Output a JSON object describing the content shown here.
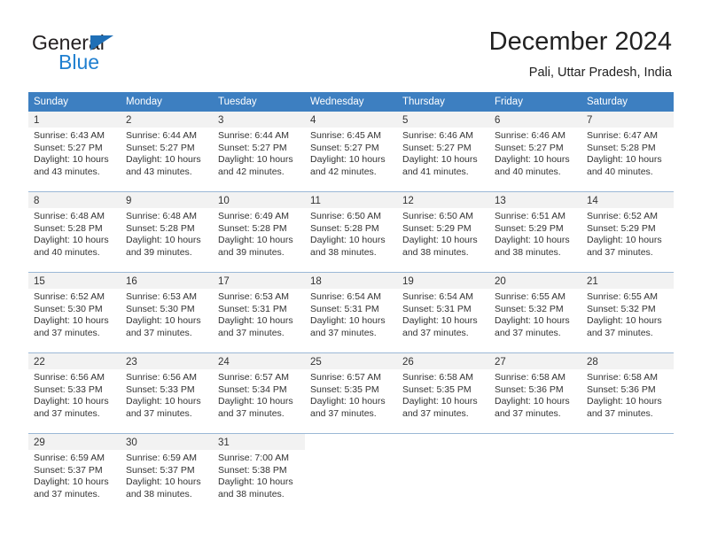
{
  "brand": {
    "name_part1": "General",
    "name_part2": "Blue",
    "triangle_color": "#1f6fb6",
    "blue_text_color": "#1f7fd0"
  },
  "header": {
    "title": "December 2024",
    "subtitle": "Pali, Uttar Pradesh, India",
    "accent_color": "#3d7fc1"
  },
  "weekdays": [
    "Sunday",
    "Monday",
    "Tuesday",
    "Wednesday",
    "Thursday",
    "Friday",
    "Saturday"
  ],
  "labels": {
    "sunrise_prefix": "Sunrise:",
    "sunset_prefix": "Sunset:",
    "daylight_prefix": "Daylight:"
  },
  "weeks": [
    [
      {
        "day": "1",
        "sunrise": "Sunrise: 6:43 AM",
        "sunset": "Sunset: 5:27 PM",
        "daylight1": "Daylight: 10 hours",
        "daylight2": "and 43 minutes."
      },
      {
        "day": "2",
        "sunrise": "Sunrise: 6:44 AM",
        "sunset": "Sunset: 5:27 PM",
        "daylight1": "Daylight: 10 hours",
        "daylight2": "and 43 minutes."
      },
      {
        "day": "3",
        "sunrise": "Sunrise: 6:44 AM",
        "sunset": "Sunset: 5:27 PM",
        "daylight1": "Daylight: 10 hours",
        "daylight2": "and 42 minutes."
      },
      {
        "day": "4",
        "sunrise": "Sunrise: 6:45 AM",
        "sunset": "Sunset: 5:27 PM",
        "daylight1": "Daylight: 10 hours",
        "daylight2": "and 42 minutes."
      },
      {
        "day": "5",
        "sunrise": "Sunrise: 6:46 AM",
        "sunset": "Sunset: 5:27 PM",
        "daylight1": "Daylight: 10 hours",
        "daylight2": "and 41 minutes."
      },
      {
        "day": "6",
        "sunrise": "Sunrise: 6:46 AM",
        "sunset": "Sunset: 5:27 PM",
        "daylight1": "Daylight: 10 hours",
        "daylight2": "and 40 minutes."
      },
      {
        "day": "7",
        "sunrise": "Sunrise: 6:47 AM",
        "sunset": "Sunset: 5:28 PM",
        "daylight1": "Daylight: 10 hours",
        "daylight2": "and 40 minutes."
      }
    ],
    [
      {
        "day": "8",
        "sunrise": "Sunrise: 6:48 AM",
        "sunset": "Sunset: 5:28 PM",
        "daylight1": "Daylight: 10 hours",
        "daylight2": "and 40 minutes."
      },
      {
        "day": "9",
        "sunrise": "Sunrise: 6:48 AM",
        "sunset": "Sunset: 5:28 PM",
        "daylight1": "Daylight: 10 hours",
        "daylight2": "and 39 minutes."
      },
      {
        "day": "10",
        "sunrise": "Sunrise: 6:49 AM",
        "sunset": "Sunset: 5:28 PM",
        "daylight1": "Daylight: 10 hours",
        "daylight2": "and 39 minutes."
      },
      {
        "day": "11",
        "sunrise": "Sunrise: 6:50 AM",
        "sunset": "Sunset: 5:28 PM",
        "daylight1": "Daylight: 10 hours",
        "daylight2": "and 38 minutes."
      },
      {
        "day": "12",
        "sunrise": "Sunrise: 6:50 AM",
        "sunset": "Sunset: 5:29 PM",
        "daylight1": "Daylight: 10 hours",
        "daylight2": "and 38 minutes."
      },
      {
        "day": "13",
        "sunrise": "Sunrise: 6:51 AM",
        "sunset": "Sunset: 5:29 PM",
        "daylight1": "Daylight: 10 hours",
        "daylight2": "and 38 minutes."
      },
      {
        "day": "14",
        "sunrise": "Sunrise: 6:52 AM",
        "sunset": "Sunset: 5:29 PM",
        "daylight1": "Daylight: 10 hours",
        "daylight2": "and 37 minutes."
      }
    ],
    [
      {
        "day": "15",
        "sunrise": "Sunrise: 6:52 AM",
        "sunset": "Sunset: 5:30 PM",
        "daylight1": "Daylight: 10 hours",
        "daylight2": "and 37 minutes."
      },
      {
        "day": "16",
        "sunrise": "Sunrise: 6:53 AM",
        "sunset": "Sunset: 5:30 PM",
        "daylight1": "Daylight: 10 hours",
        "daylight2": "and 37 minutes."
      },
      {
        "day": "17",
        "sunrise": "Sunrise: 6:53 AM",
        "sunset": "Sunset: 5:31 PM",
        "daylight1": "Daylight: 10 hours",
        "daylight2": "and 37 minutes."
      },
      {
        "day": "18",
        "sunrise": "Sunrise: 6:54 AM",
        "sunset": "Sunset: 5:31 PM",
        "daylight1": "Daylight: 10 hours",
        "daylight2": "and 37 minutes."
      },
      {
        "day": "19",
        "sunrise": "Sunrise: 6:54 AM",
        "sunset": "Sunset: 5:31 PM",
        "daylight1": "Daylight: 10 hours",
        "daylight2": "and 37 minutes."
      },
      {
        "day": "20",
        "sunrise": "Sunrise: 6:55 AM",
        "sunset": "Sunset: 5:32 PM",
        "daylight1": "Daylight: 10 hours",
        "daylight2": "and 37 minutes."
      },
      {
        "day": "21",
        "sunrise": "Sunrise: 6:55 AM",
        "sunset": "Sunset: 5:32 PM",
        "daylight1": "Daylight: 10 hours",
        "daylight2": "and 37 minutes."
      }
    ],
    [
      {
        "day": "22",
        "sunrise": "Sunrise: 6:56 AM",
        "sunset": "Sunset: 5:33 PM",
        "daylight1": "Daylight: 10 hours",
        "daylight2": "and 37 minutes."
      },
      {
        "day": "23",
        "sunrise": "Sunrise: 6:56 AM",
        "sunset": "Sunset: 5:33 PM",
        "daylight1": "Daylight: 10 hours",
        "daylight2": "and 37 minutes."
      },
      {
        "day": "24",
        "sunrise": "Sunrise: 6:57 AM",
        "sunset": "Sunset: 5:34 PM",
        "daylight1": "Daylight: 10 hours",
        "daylight2": "and 37 minutes."
      },
      {
        "day": "25",
        "sunrise": "Sunrise: 6:57 AM",
        "sunset": "Sunset: 5:35 PM",
        "daylight1": "Daylight: 10 hours",
        "daylight2": "and 37 minutes."
      },
      {
        "day": "26",
        "sunrise": "Sunrise: 6:58 AM",
        "sunset": "Sunset: 5:35 PM",
        "daylight1": "Daylight: 10 hours",
        "daylight2": "and 37 minutes."
      },
      {
        "day": "27",
        "sunrise": "Sunrise: 6:58 AM",
        "sunset": "Sunset: 5:36 PM",
        "daylight1": "Daylight: 10 hours",
        "daylight2": "and 37 minutes."
      },
      {
        "day": "28",
        "sunrise": "Sunrise: 6:58 AM",
        "sunset": "Sunset: 5:36 PM",
        "daylight1": "Daylight: 10 hours",
        "daylight2": "and 37 minutes."
      }
    ],
    [
      {
        "day": "29",
        "sunrise": "Sunrise: 6:59 AM",
        "sunset": "Sunset: 5:37 PM",
        "daylight1": "Daylight: 10 hours",
        "daylight2": "and 37 minutes."
      },
      {
        "day": "30",
        "sunrise": "Sunrise: 6:59 AM",
        "sunset": "Sunset: 5:37 PM",
        "daylight1": "Daylight: 10 hours",
        "daylight2": "and 38 minutes."
      },
      {
        "day": "31",
        "sunrise": "Sunrise: 7:00 AM",
        "sunset": "Sunset: 5:38 PM",
        "daylight1": "Daylight: 10 hours",
        "daylight2": "and 38 minutes."
      },
      {
        "day": "",
        "sunrise": "",
        "sunset": "",
        "daylight1": "",
        "daylight2": ""
      },
      {
        "day": "",
        "sunrise": "",
        "sunset": "",
        "daylight1": "",
        "daylight2": ""
      },
      {
        "day": "",
        "sunrise": "",
        "sunset": "",
        "daylight1": "",
        "daylight2": ""
      },
      {
        "day": "",
        "sunrise": "",
        "sunset": "",
        "daylight1": "",
        "daylight2": ""
      }
    ]
  ]
}
